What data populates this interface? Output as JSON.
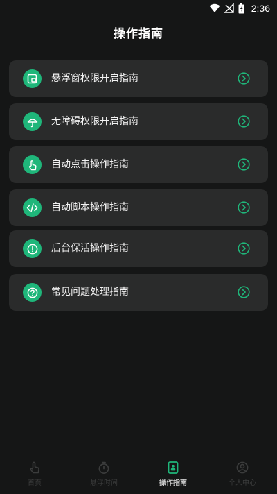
{
  "status_bar": {
    "time": "2:36"
  },
  "header": {
    "title": "操作指南"
  },
  "guides": [
    {
      "label": "悬浮窗权限开启指南",
      "icon": "floating-window-icon"
    },
    {
      "label": "无障碍权限开启指南",
      "icon": "umbrella-icon"
    },
    {
      "label": "自动点击操作指南",
      "icon": "tap-hand-icon"
    },
    {
      "label": "自动脚本操作指南",
      "icon": "code-icon"
    },
    {
      "label": "后台保活操作指南",
      "icon": "alert-icon"
    },
    {
      "label": "常见问题处理指南",
      "icon": "question-icon"
    }
  ],
  "bottom_nav": [
    {
      "label": "首页",
      "icon": "tap-hand-icon",
      "active": false
    },
    {
      "label": "悬浮时间",
      "icon": "stopwatch-icon",
      "active": false
    },
    {
      "label": "操作指南",
      "icon": "guide-book-icon",
      "active": true
    },
    {
      "label": "个人中心",
      "icon": "person-icon",
      "active": false
    }
  ],
  "colors": {
    "accent": "#1fb67a",
    "background": "#151616",
    "card": "#2a2b2b",
    "nav_inactive": "#3b3c3c"
  }
}
